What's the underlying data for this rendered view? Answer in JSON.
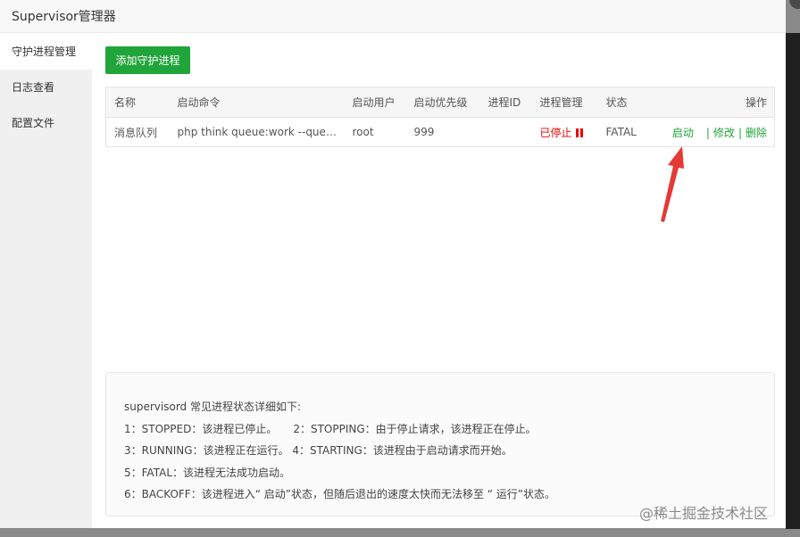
{
  "window": {
    "title": "Supervisor管理器"
  },
  "sidebar": {
    "items": [
      {
        "label": "守护进程管理"
      },
      {
        "label": "日志查看"
      },
      {
        "label": "配置文件"
      }
    ]
  },
  "toolbar": {
    "add_label": "添加守护进程"
  },
  "table": {
    "headers": {
      "name": "名称",
      "command": "启动命令",
      "user": "启动用户",
      "priority": "启动优先级",
      "pid": "进程ID",
      "manage": "进程管理",
      "status": "状态",
      "ops": "操作"
    },
    "rows": [
      {
        "name": "消息队列",
        "command": "php think queue:work --queue=default",
        "user": "root",
        "priority": "999",
        "pid": "",
        "manage": "已停止",
        "status": "FATAL",
        "actions": {
          "start": "启动",
          "edit": "修改",
          "delete": "删除",
          "separator": "|"
        }
      }
    ]
  },
  "info": {
    "title": "supervisord 常见进程状态详细如下:",
    "lines": [
      "1：STOPPED：该进程已停止。　　2：STOPPING：由于停止请求，该进程正在停止。",
      "3：RUNNING：该进程正在运行。 4：STARTING：该进程由于启动请求而开始。",
      "5：FATAL：该进程无法成功启动。",
      "6：BACKOFF：该进程进入“ 启动”状态，但随后退出的速度太快而无法移至 “ 运行”状态。"
    ]
  },
  "watermark": "@稀土掘金技术社区",
  "colors": {
    "accent": "#20a53a",
    "danger": "#ee0000",
    "annotation": "#e53935"
  }
}
